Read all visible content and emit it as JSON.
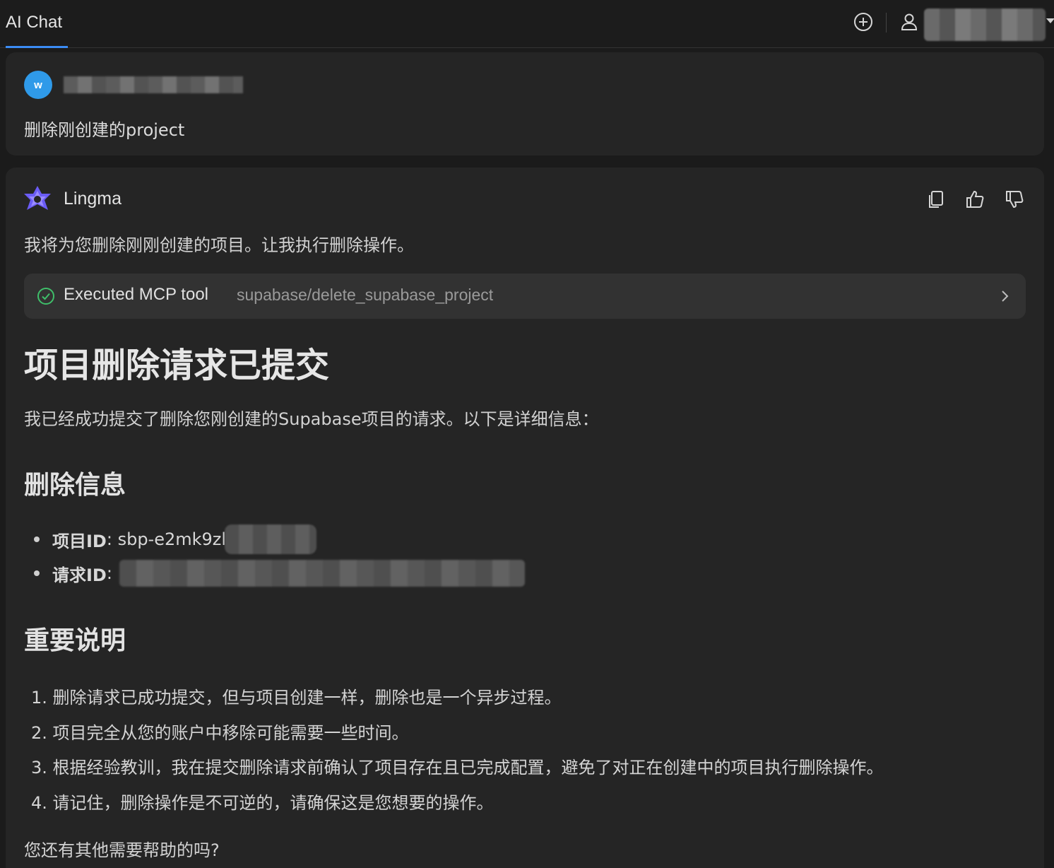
{
  "header": {
    "tab_label": "AI Chat",
    "icons": [
      "plus-circle-icon",
      "user-icon",
      "chevron-down-icon"
    ]
  },
  "user_message": {
    "avatar_letter": "w",
    "text": "删除刚创建的project"
  },
  "assistant": {
    "name": "Lingma",
    "actions": [
      "copy-icon",
      "thumbs-up-icon",
      "thumbs-down-icon"
    ],
    "intro": "我将为您删除刚刚创建的项目。让我执行删除操作。",
    "tool": {
      "label": "Executed MCP tool",
      "name": "supabase/delete_supabase_project"
    },
    "heading": "项目删除请求已提交",
    "summary": "我已经成功提交了删除您刚创建的Supabase项目的请求。以下是详细信息：",
    "section1_title": "删除信息",
    "details": [
      {
        "key": "项目ID",
        "value": ": sbp-e2mk9zl"
      },
      {
        "key": "请求ID",
        "value": ":"
      }
    ],
    "section2_title": "重要说明",
    "notes": [
      "1. 删除请求已成功提交，但与项目创建一样，删除也是一个异步过程。",
      "2. 项目完全从您的账户中移除可能需要一些时间。",
      "3. 根据经验教训，我在提交删除请求前确认了项目存在且已完成配置，避免了对正在创建中的项目执行删除操作。",
      "4. 请记住，删除操作是不可逆的，请确保这是您想要的操作。"
    ],
    "closing": "您还有其他需要帮助的吗?"
  },
  "colors": {
    "background": "#1b1b1b",
    "card": "#252525",
    "accent": "#3b8cf5",
    "avatar": "#2f9ae9",
    "success": "#3fbf6a"
  }
}
